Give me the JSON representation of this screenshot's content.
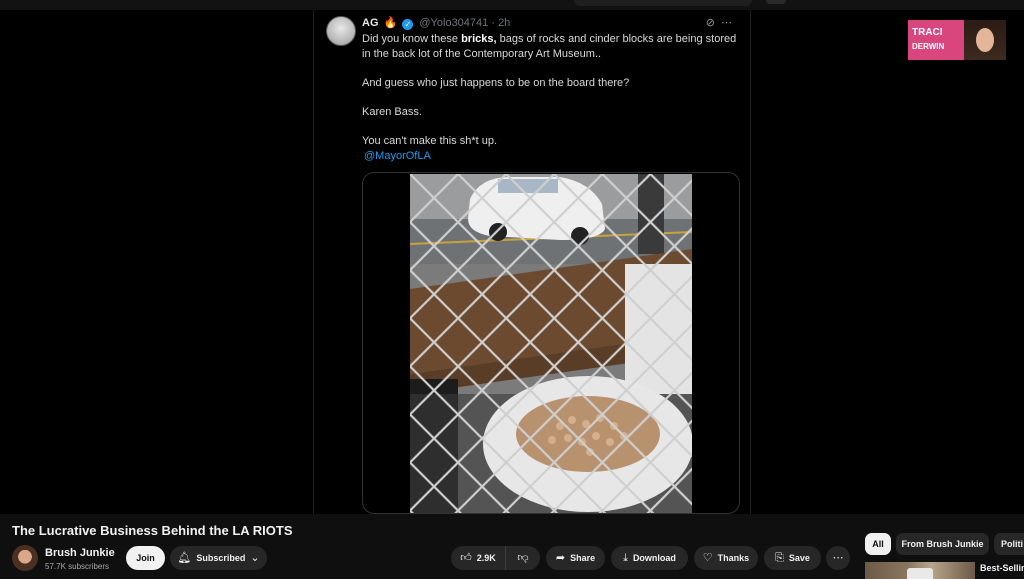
{
  "tweet": {
    "author_name": "AG",
    "author_emoji": "🔥",
    "handle": "@Yolo304741",
    "time": "· 2h",
    "icons": [
      "grok-icon",
      "more-icon"
    ],
    "line1_pre": "Did you know these ",
    "line1_bold": "bricks,",
    "line1_post": " bags of rocks and cinder blocks are being stored in the back lot of the Contemporary Art Museum..",
    "line2": "And guess who just happens to be on the board there?",
    "line3": "Karen Bass.",
    "line4": "You can't make this sh*t up.",
    "mention": "@MayorOfLA"
  },
  "pip": {
    "line1": "TRACI",
    "line2": "DERWIN"
  },
  "video": {
    "title": "The Lucrative Business Behind the LA RIOTS"
  },
  "channel": {
    "name": "Brush Junkie",
    "subscribers": "57.7K subscribers",
    "join_label": "Join",
    "subscribed_label": "Subscribed"
  },
  "actions": {
    "likes": "2.9K",
    "share": "Share",
    "download": "Download",
    "thanks": "Thanks",
    "save": "Save"
  },
  "chips": [
    "All",
    "From Brush Junkie",
    "Politi"
  ],
  "recommendation": {
    "title": "Best-Sellin"
  },
  "colors": {
    "background": "#0f0f0f",
    "button": "#272727",
    "link": "#1d9bf0",
    "pip_pink": "#d9467e"
  }
}
